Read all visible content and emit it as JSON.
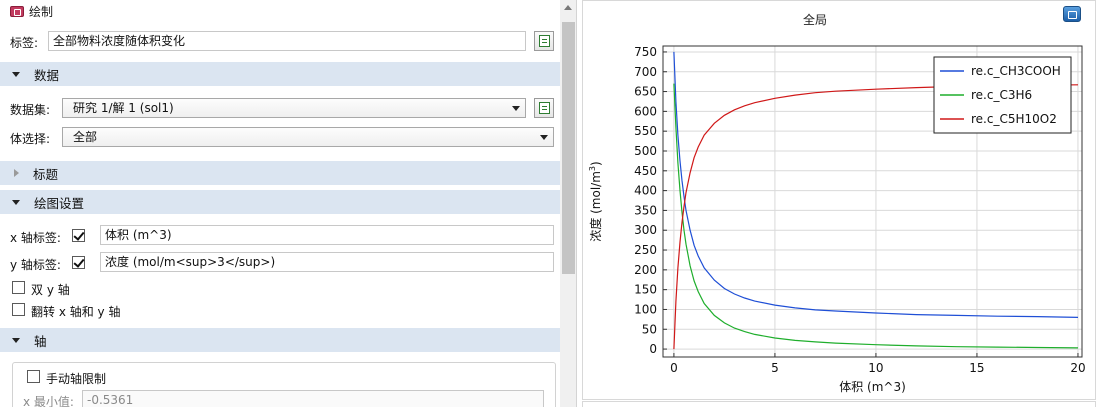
{
  "toolbar": {
    "label": "绘制"
  },
  "label_row": {
    "label": "标签:",
    "value": "全部物料浓度随体积变化"
  },
  "sections": {
    "data": "数据",
    "title": "标题",
    "plot_settings": "绘图设置",
    "axis": "轴"
  },
  "data_section": {
    "dataset_label": "数据集:",
    "dataset_value": "研究 1/解 1 (sol1)",
    "selection_label": "体选择:",
    "selection_value": "全部"
  },
  "plot_settings": {
    "x_label_label": "x 轴标签:",
    "x_label_checked": true,
    "x_label_value": "体积 (m^3)",
    "y_label_label": "y 轴标签:",
    "y_label_checked": true,
    "y_label_value": "浓度 (mol/m<sup>3</sup>)",
    "dual_y_label": "双 y 轴",
    "dual_y_checked": false,
    "flip_axes_label": "翻转 x 轴和 y 轴",
    "flip_axes_checked": false
  },
  "axis_section": {
    "manual_limits_label": "手动轴限制",
    "manual_limits_checked": false,
    "x_min_label": "x 最小值:",
    "x_min_value": "-0.5361"
  },
  "plot": {
    "window_title": "全局"
  },
  "chart_data": {
    "type": "line",
    "title": "",
    "xlabel": "体积 (m^3)",
    "ylabel": "浓度 (mol/m",
    "ylabel_sup": "3",
    "ylabel_close": ")",
    "xlim": [
      -0.54,
      20.2
    ],
    "ylim": [
      -20,
      765
    ],
    "xticks": [
      0,
      5,
      10,
      15,
      20
    ],
    "yticks": [
      0,
      50,
      100,
      150,
      200,
      250,
      300,
      350,
      400,
      450,
      500,
      550,
      600,
      650,
      700,
      750
    ],
    "grid": true,
    "legend_position": "top-right",
    "x": [
      0,
      0.1,
      0.2,
      0.3,
      0.4,
      0.5,
      0.6,
      0.8,
      1.0,
      1.2,
      1.5,
      2.0,
      2.5,
      3.0,
      3.5,
      4.0,
      5.0,
      6.0,
      7.0,
      8.0,
      10.0,
      12.0,
      14.0,
      16.0,
      18.0,
      20.0
    ],
    "series": [
      {
        "name": "re.c_CH3COOH",
        "color": "#1f4fd6",
        "values": [
          750,
          625,
          540,
          475,
          425,
          385,
          350,
          300,
          262,
          235,
          205,
          174,
          153,
          139,
          129,
          121,
          111,
          104,
          99,
          96,
          91,
          87,
          85,
          83,
          82,
          80
        ]
      },
      {
        "name": "re.c_C3H6",
        "color": "#1fae2c",
        "values": [
          670,
          560,
          470,
          400,
          345,
          300,
          265,
          210,
          172,
          145,
          115,
          85,
          66,
          53,
          44,
          37,
          28,
          22,
          18,
          15,
          11,
          8,
          6,
          5,
          4,
          3
        ]
      },
      {
        "name": "re.c_C5H10O2",
        "color": "#d01818",
        "values": [
          0,
          120,
          205,
          270,
          320,
          360,
          395,
          445,
          483,
          510,
          540,
          570,
          590,
          604,
          614,
          622,
          633,
          641,
          647,
          651,
          656,
          660,
          663,
          665,
          666,
          667
        ]
      }
    ]
  }
}
